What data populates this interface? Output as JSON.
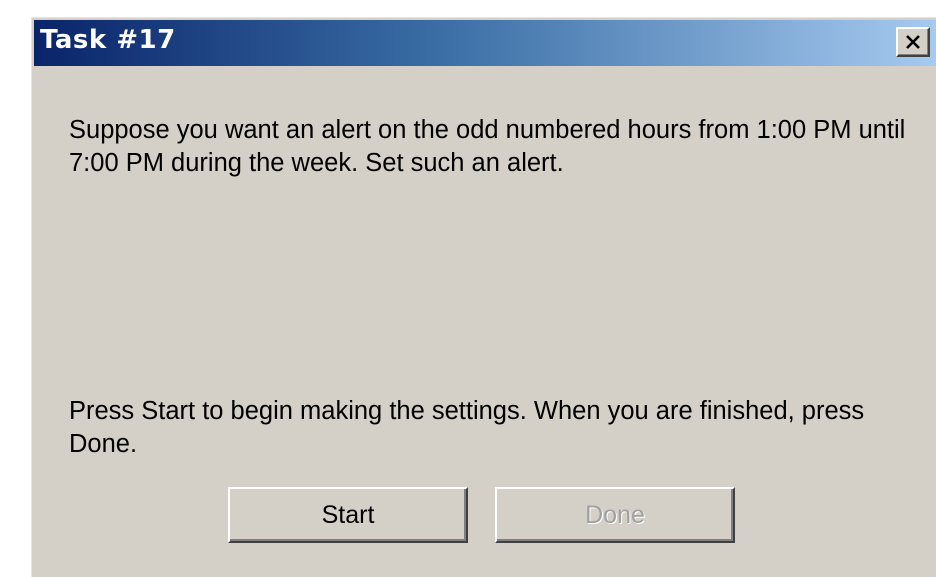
{
  "window": {
    "title": "Task #17",
    "close_icon": "close-icon"
  },
  "content": {
    "instruction": "Suppose you want an alert on the odd numbered hours from 1:00 PM until 7:00 PM during the week. Set such an alert.",
    "hint": "Press Start to begin making the settings. When you are finished, press Done."
  },
  "buttons": {
    "start_label": "Start",
    "done_label": "Done",
    "done_state": "disabled"
  },
  "colors": {
    "titlebar_start": "#0a246a",
    "titlebar_end": "#a6caf0",
    "face": "#d4d0c8"
  }
}
